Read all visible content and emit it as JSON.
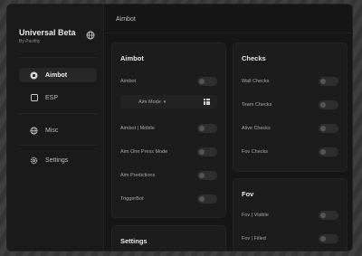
{
  "window": {
    "title": "Aimbot"
  },
  "brand": {
    "title": "Universal Beta",
    "subtitle": "By Pacifity",
    "icon": "globe-icon"
  },
  "sidebar": {
    "items": [
      {
        "label": "Aimbot",
        "icon": "target-icon",
        "active": true
      },
      {
        "label": "ESP",
        "icon": "square-icon",
        "active": false
      },
      {
        "label": "Misc",
        "icon": "globe-icon",
        "active": false
      },
      {
        "label": "Settings",
        "icon": "gear-icon",
        "active": false
      }
    ]
  },
  "aimbot_card": {
    "title": "Aimbot",
    "rows": [
      {
        "label": "Aimbot",
        "on": false
      },
      {
        "label": "Aimbot | Mobile",
        "on": false
      },
      {
        "label": "Aim One Press Mode",
        "on": false
      },
      {
        "label": "Aim Predictions",
        "on": false
      },
      {
        "label": "TriggerBot",
        "on": false
      }
    ],
    "dropdown": {
      "label": "Aim Mode",
      "chevron": "▾",
      "icon": "grid-icon"
    }
  },
  "settings_card": {
    "title": "Settings"
  },
  "checks_card": {
    "title": "Checks",
    "rows": [
      {
        "label": "Wall Checks",
        "on": false
      },
      {
        "label": "Team Checks",
        "on": false
      },
      {
        "label": "Alive Checks",
        "on": false
      },
      {
        "label": "Fov Checks",
        "on": false
      }
    ]
  },
  "fov_card": {
    "title": "Fov",
    "rows": [
      {
        "label": "Fov | Visible",
        "on": false
      },
      {
        "label": "Fov | Filled",
        "on": false
      }
    ]
  },
  "colors": {
    "close_dot": "#e5534b",
    "window_bg": "#161616",
    "card_bg": "#1c1c1c"
  }
}
